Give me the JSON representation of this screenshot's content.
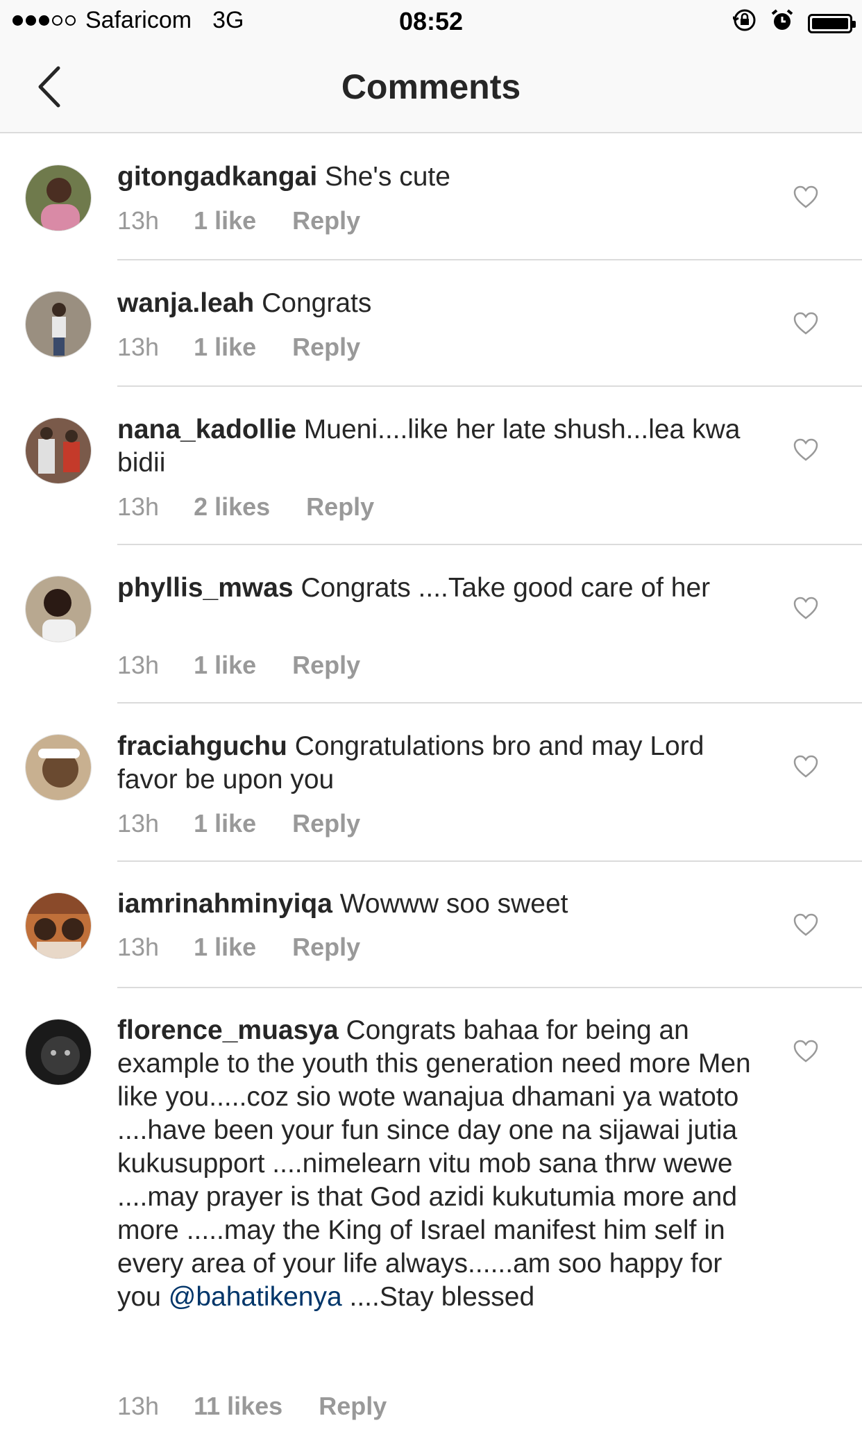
{
  "status_bar": {
    "carrier": "Safaricom",
    "network": "3G",
    "time": "08:52",
    "icons": [
      "rotation-lock-icon",
      "alarm-icon",
      "battery-icon"
    ]
  },
  "nav": {
    "title": "Comments",
    "back_icon": "chevron-left-icon"
  },
  "comments": [
    {
      "username": "gitongadkangai",
      "text": "She's cute",
      "time": "13h",
      "likes": "1 like",
      "reply": "Reply",
      "avatar_color": "#d98aa6"
    },
    {
      "username": "wanja.leah",
      "text": "Congrats",
      "time": "13h",
      "likes": "1 like",
      "reply": "Reply",
      "avatar_color": "#8a7b6a"
    },
    {
      "username": "nana_kadollie",
      "text": "Mueni....like her late shush...lea kwa bidii",
      "time": "13h",
      "likes": "2 likes",
      "reply": "Reply",
      "avatar_color": "#b84a3a"
    },
    {
      "username": "phyllis_mwas",
      "text": "Congrats ....Take good care of her",
      "time": "13h",
      "likes": "1 like",
      "reply": "Reply",
      "avatar_color": "#6a5544"
    },
    {
      "username": "fraciahguchu",
      "text": "Congratulations bro and may Lord favor be upon you",
      "time": "13h",
      "likes": "1 like",
      "reply": "Reply",
      "avatar_color": "#a08060"
    },
    {
      "username": "iamrinahminyiqa",
      "text": "Wowww soo sweet",
      "time": "13h",
      "likes": "1 like",
      "reply": "Reply",
      "avatar_color": "#c0703a"
    },
    {
      "username": "florence_muasya",
      "text": "Congrats bahaa for being an example to the youth this generation need more Men like you.....coz sio wote wanajua dhamani ya watoto ....have been your fun since day one na sijawai jutia kukusupport ....nimelearn vitu mob sana thrw wewe ....may prayer is that God azidi kukutumia more and more .....may the King of Israel manifest him self in every area of your life always......am soo happy for you",
      "mention": "@bahatikenya",
      "text_after": "....Stay blessed",
      "time": "13h",
      "likes": "11 likes",
      "reply": "Reply",
      "avatar_color": "#2a2a2a"
    }
  ]
}
